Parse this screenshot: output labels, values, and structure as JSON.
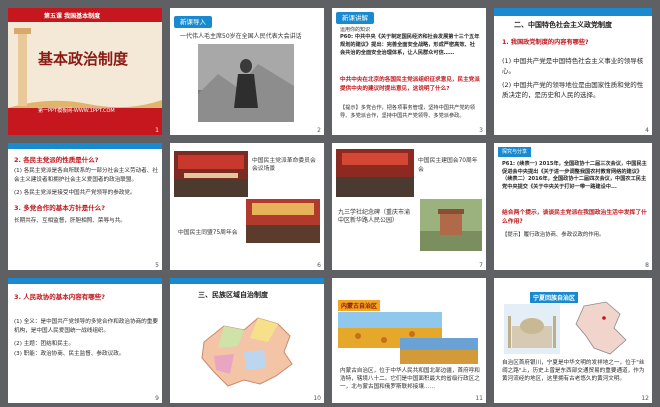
{
  "slides": [
    {
      "num": "1",
      "lesson": "第五课  我国基本制度",
      "title": "基本政治制度",
      "footer": "第一PPT模板网-WWW.1PPT.COM"
    },
    {
      "num": "2",
      "header": "新课导入",
      "caption": "一代伟人毛主席50岁在全国人民代表大会讲话"
    },
    {
      "num": "3",
      "header": "新课讲解",
      "sub": "运用你的知识",
      "para1": "P60:  中共中央《关于制定国民经济和社会发展第十三个五年规划的建议》提出：完善全面安全战略，形成严密高效、社会共治的全面安全治理体系，让人民群众可信……",
      "question": "中共中央在北京的各国民主党派组织征求意见，民主党派提供中央的建议时提出意见，这说明了什么?",
      "tip": "【提示】多党合作，把各项事务管理，坚持中国共产党的领导、多党派合作，坚持中国共产党领导、多党派参政。"
    },
    {
      "num": "4",
      "title": "二、中国特色社会主义政党制度",
      "q1": "1. 我国政党制度的内容有哪些?",
      "a1": "(1) 中国共产党是中国特色社会主义事业的领导核心。",
      "a2": "(2) 中国共产党的领导地位是由国家性质和党的性质决定的，是历史和人民的选择。"
    },
    {
      "num": "5",
      "q2": "2. 各民主党派的性质是什么?",
      "a3": "(1) 各民主党派是各自所联系的一部分社会主义劳动者、社会主义建设者和拥护社会主义爱国者的政治联盟。",
      "a4": "(2) 各民主党派是接受中国共产党领导的参政党。",
      "q3": "3. 多党合作的基本方针是什么?",
      "a5": "长期共存、互相监督，肝胆相照、荣辱与共。"
    },
    {
      "num": "6",
      "cap1": "中国民主党派革命委员会会议场景",
      "cap2": "中国民主同盟75周年会"
    },
    {
      "num": "7",
      "cap1": "中国民主建国会70周年会",
      "cap2": "九三学社纪念碑（重庆市渝中区新华路人民公园）"
    },
    {
      "num": "8",
      "tag": "探究与分享",
      "para": "P61: (续表一) 2015年，全国政协十二届三次会议，中国民主促进会中央提出《关于进一步调整我国农村教育网络的建议》（续表二）2016年，全国政协十二届四次会议，中国农工民主党中央提交《关于中央关于打好一带一路建设中...",
      "question": "结合两个提示，谈谈民主党派在我国政治生活中发挥了什么作用?",
      "tip": "【提示】履行政治协商、参政议政的作用。"
    },
    {
      "num": "9",
      "q": "3. 人民政协的基本内容有哪些?",
      "a1": "(1) 全义：是中国共产党领导的多党合作和政治协商的重要机构，是中国人民爱国统一战线组织。",
      "a2": "(2) 主题：团结和民主。",
      "a3": "(3) 职能：政治协商、民主监督、参政议政。"
    },
    {
      "num": "10",
      "title": "三、民族区域自治制度"
    },
    {
      "num": "11",
      "region": "内蒙古自治区",
      "para": "内蒙古自治区，位于中华人民共和国北部边疆，首府呼和浩特，辖境八十二。它们是中国面积最大的省级行政区之一，北与蒙古国和俄罗斯联邦接壤……"
    },
    {
      "num": "12",
      "region": "宁夏回族自治区",
      "para": "自治区首府银川，宁夏是中华文明的发祥地之一，位于\"丝绸之路\"上，历史上曾是东西部交通贸易的重要通道，作为黄河流经的地区，这里拥有古老悠久的黄河文明。"
    }
  ],
  "colors": {
    "red": "#c0171e",
    "blue": "#2a5ec4",
    "header_blue": "#1a8ad0",
    "background": "#5f6063"
  }
}
